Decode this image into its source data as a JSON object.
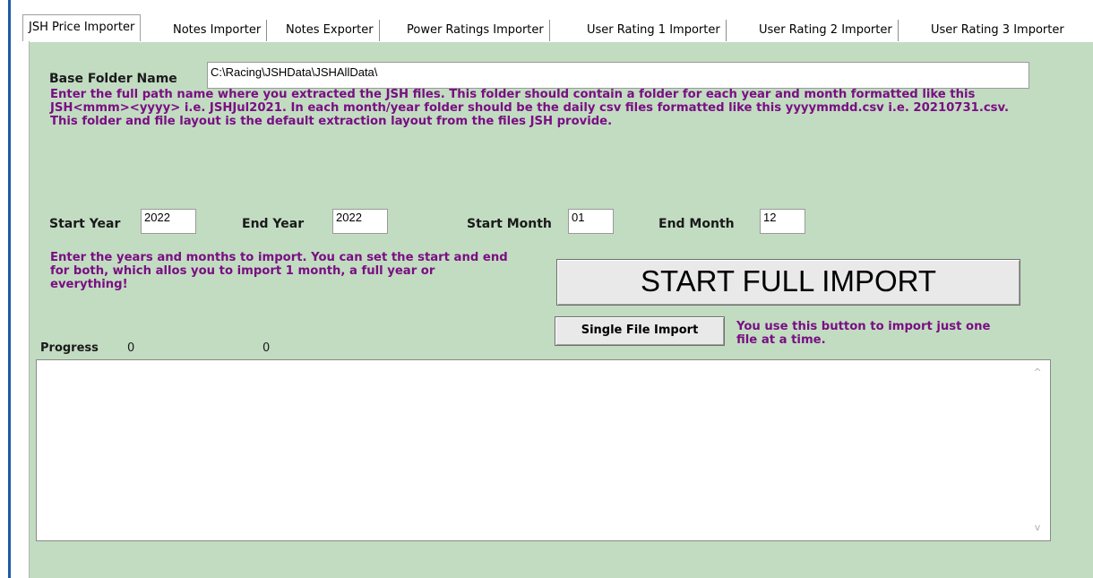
{
  "tabs": [
    {
      "label": "JSH Price Importer"
    },
    {
      "label": "Notes Importer"
    },
    {
      "label": "Notes Exporter"
    },
    {
      "label": "Power Ratings Importer"
    },
    {
      "label": "User Rating 1 Importer"
    },
    {
      "label": "User Rating 2 Importer"
    },
    {
      "label": "User Rating 3 Importer"
    }
  ],
  "base_folder": {
    "label": "Base Folder Name",
    "value": "C:\\Racing\\JSHData\\JSHAllData\\",
    "help": "Enter the full path name where you extracted the JSH files.  This folder should contain a folder for each year and month formatted like this JSH<mmm><yyyy> i.e. JSHJul2021.  In each month/year folder should be the daily csv files formatted like this yyyymmdd.csv i.e. 20210731.csv.  This folder and file layout is the default extraction layout from the files JSH provide."
  },
  "dates": {
    "start_year_label": "Start Year",
    "start_year_value": "2022",
    "end_year_label": "End Year",
    "end_year_value": "2022",
    "start_month_label": "Start Month",
    "start_month_value": "01",
    "end_month_label": "End Month",
    "end_month_value": "12",
    "help": "Enter the years and months to import.  You can set the start and end for both, which allos you to import 1 month, a full year or everything!"
  },
  "buttons": {
    "start_full_import": "START FULL IMPORT",
    "single_file_import": "Single File Import",
    "single_file_help": "You use this button to import just one file at a time."
  },
  "progress": {
    "label": "Progress",
    "value1": "0",
    "value2": "0"
  },
  "log": {
    "scroll_up_glyph": "^",
    "scroll_down_glyph": "v"
  },
  "colors": {
    "panel_bg": "#c2dcc2",
    "help_text": "#7a0e83"
  }
}
